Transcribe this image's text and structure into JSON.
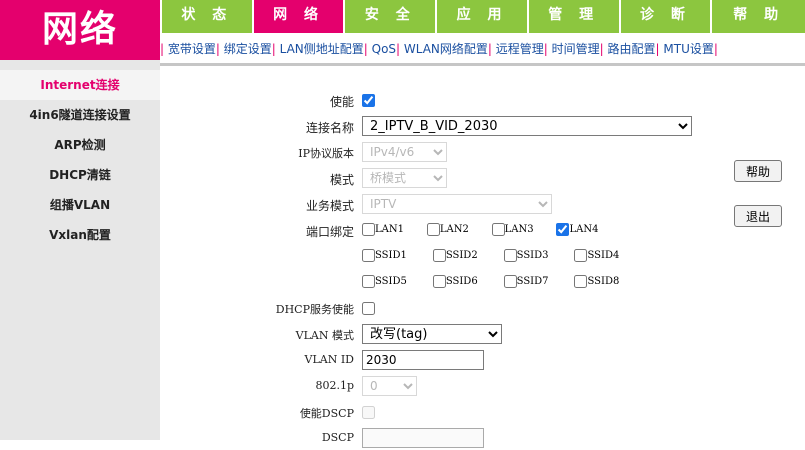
{
  "logo": "网络",
  "topnav": [
    "状 态",
    "网 络",
    "安 全",
    "应 用",
    "管 理",
    "诊 断",
    "帮 助"
  ],
  "subnav": [
    "宽带设置",
    "绑定设置",
    "LAN侧地址配置",
    "QoS",
    "WLAN网络配置",
    "远程管理",
    "时间管理",
    "路由配置",
    "MTU设置"
  ],
  "sidebar": [
    "Internet连接",
    "4in6隧道连接设置",
    "ARP检测",
    "DHCP清链",
    "组播VLAN",
    "Vxlan配置"
  ],
  "form": {
    "enable_label": "使能",
    "conn_name_label": "连接名称",
    "conn_name_value": "2_IPTV_B_VID_2030",
    "ip_version_label": "IP协议版本",
    "ip_version_value": "IPv4/v6",
    "mode_label": "模式",
    "mode_value": "桥模式",
    "service_mode_label": "业务模式",
    "service_mode_value": "IPTV",
    "port_bind_label": "端口绑定",
    "ports_row1": [
      "LAN1",
      "LAN2",
      "LAN3",
      "LAN4"
    ],
    "ports_row2": [
      "SSID1",
      "SSID2",
      "SSID3",
      "SSID4"
    ],
    "ports_row3": [
      "SSID5",
      "SSID6",
      "SSID7",
      "SSID8"
    ],
    "dhcp_label": "DHCP服务使能",
    "vlan_mode_label": "VLAN 模式",
    "vlan_mode_value": "改写(tag)",
    "vlan_id_label": "VLAN ID",
    "vlan_id_value": "2030",
    "p8021_label": "802.1p",
    "p8021_value": "0",
    "dscp_enable_label": "使能DSCP",
    "dscp_label": "DSCP"
  },
  "buttons": {
    "help": "帮助",
    "exit": "退出"
  }
}
